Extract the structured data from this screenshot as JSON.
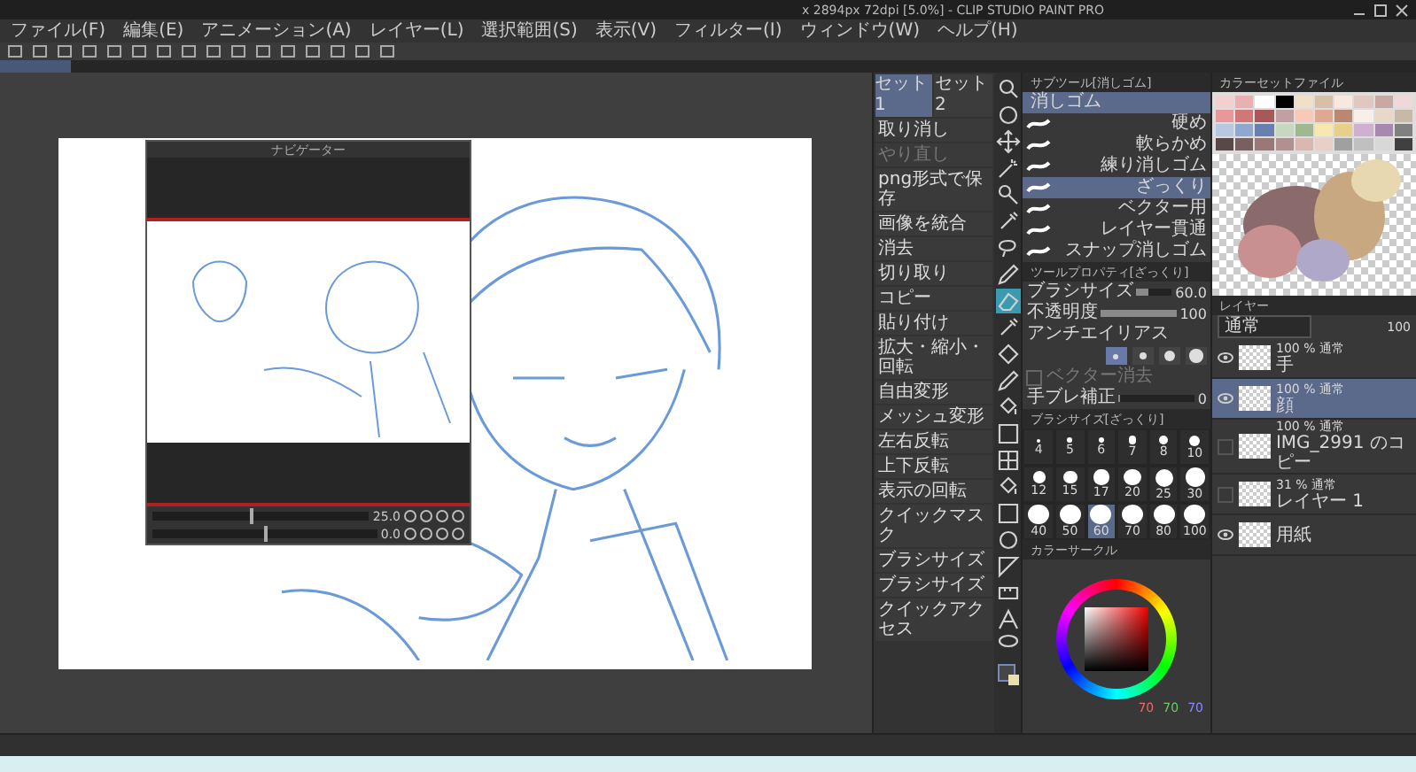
{
  "window": {
    "title": "x 2894px 72dpi [5.0%] - CLIP STUDIO PAINT PRO"
  },
  "menu": [
    "ファイル(F)",
    "編集(E)",
    "アニメーション(A)",
    "レイヤー(L)",
    "選択範囲(S)",
    "表示(V)",
    "フィルター(I)",
    "ウィンドウ(W)",
    "ヘルプ(H)"
  ],
  "navigator": {
    "title": "ナビゲーター",
    "zoom": "25.0",
    "rotation": "0.0",
    "zoom_slider": {
      "level": 0.45
    },
    "rotation_slider": {
      "level": 0.5
    }
  },
  "auto_actions": {
    "sets": [
      {
        "label": "セット1",
        "selected": true
      },
      {
        "label": "セット2",
        "selected": false
      }
    ],
    "items": [
      {
        "label": "取り消し",
        "disabled": false
      },
      {
        "label": "やり直し",
        "disabled": true
      },
      {
        "label": "png形式で保存",
        "disabled": false
      },
      {
        "label": "画像を統合",
        "disabled": false
      },
      {
        "label": "消去",
        "disabled": false
      },
      {
        "label": "切り取り",
        "disabled": false
      },
      {
        "label": "コピー",
        "disabled": false
      },
      {
        "label": "貼り付け",
        "disabled": false
      },
      {
        "label": "拡大・縮小・回転",
        "disabled": false
      },
      {
        "label": "自由変形",
        "disabled": false
      },
      {
        "label": "メッシュ変形",
        "disabled": false
      },
      {
        "label": "左右反転",
        "disabled": false
      },
      {
        "label": "上下反転",
        "disabled": false
      },
      {
        "label": "表示の回転",
        "disabled": false
      },
      {
        "label": "クイックマスク",
        "disabled": false
      },
      {
        "label": "ブラシサイズ",
        "disabled": false
      },
      {
        "label": "ブラシサイズ",
        "disabled": false
      },
      {
        "label": "クイックアクセス",
        "disabled": false
      }
    ]
  },
  "tools": [
    {
      "kind": "magnifier",
      "selected": false
    },
    {
      "kind": "circle",
      "selected": false
    },
    {
      "kind": "move",
      "selected": false
    },
    {
      "kind": "wand",
      "selected": false
    },
    {
      "kind": "search",
      "selected": false
    },
    {
      "kind": "dropper",
      "selected": false
    },
    {
      "kind": "lasso",
      "selected": false
    },
    {
      "kind": "pen",
      "selected": false
    },
    {
      "kind": "eraser",
      "selected": true
    },
    {
      "kind": "dropper",
      "selected": false
    },
    {
      "kind": "blend",
      "selected": false
    },
    {
      "kind": "pen",
      "selected": false
    },
    {
      "kind": "fill",
      "selected": false
    },
    {
      "kind": "gradient",
      "selected": false
    },
    {
      "kind": "grid",
      "selected": false
    },
    {
      "kind": "fill",
      "selected": false
    },
    {
      "kind": "gradient",
      "selected": false
    },
    {
      "kind": "circle",
      "selected": false
    },
    {
      "kind": "frame",
      "selected": false
    },
    {
      "kind": "ruler",
      "selected": false
    },
    {
      "kind": "text",
      "selected": false
    },
    {
      "kind": "balloon",
      "selected": false
    }
  ],
  "sub_tool": {
    "title": "サブツール[消しゴム]",
    "group": "消しゴム",
    "items": [
      {
        "label": "硬め",
        "selected": false
      },
      {
        "label": "軟らかめ",
        "selected": false
      },
      {
        "label": "練り消しゴム",
        "selected": false
      },
      {
        "label": "ざっくり",
        "selected": true
      },
      {
        "label": "ベクター用",
        "selected": false
      },
      {
        "label": "レイヤー貫通",
        "selected": false
      },
      {
        "label": "スナップ消しゴム",
        "selected": false
      }
    ]
  },
  "tool_property": {
    "title": "ツールプロパティ[ざっくり]",
    "brush_size": {
      "label": "ブラシサイズ",
      "value": "60.0",
      "level": 0.35
    },
    "opacity": {
      "label": "不透明度",
      "value": "100",
      "level": 1
    },
    "antialias": {
      "label": "アンチエイリアス",
      "options": [
        {
          "selected": true
        },
        {
          "selected": false
        },
        {
          "selected": false
        },
        {
          "selected": false
        }
      ]
    },
    "vector_erase": {
      "label": "ベクター消去",
      "checked": false
    },
    "stabilization": {
      "label": "手ブレ補正",
      "value": "0",
      "level": 0
    }
  },
  "brush_sizes": {
    "title": "ブラシサイズ[ざっくり]",
    "items": [
      {
        "label": "4",
        "selected": false
      },
      {
        "label": "5",
        "selected": false
      },
      {
        "label": "6",
        "selected": false
      },
      {
        "label": "7",
        "selected": false
      },
      {
        "label": "8",
        "selected": false
      },
      {
        "label": "10",
        "selected": false
      },
      {
        "label": "12",
        "selected": false
      },
      {
        "label": "15",
        "selected": false
      },
      {
        "label": "17",
        "selected": false
      },
      {
        "label": "20",
        "selected": false
      },
      {
        "label": "25",
        "selected": false
      },
      {
        "label": "30",
        "selected": false
      },
      {
        "label": "40",
        "selected": false
      },
      {
        "label": "50",
        "selected": false
      },
      {
        "label": "60",
        "selected": true
      },
      {
        "label": "70",
        "selected": false
      },
      {
        "label": "80",
        "selected": false
      },
      {
        "label": "100",
        "selected": false
      }
    ]
  },
  "color_circle": {
    "title": "カラーサークル",
    "r": "70",
    "g": "70",
    "b": "70"
  },
  "color_set": {
    "title": "カラーセットファイル",
    "swatches": [
      {
        "color": "#f2d0d0"
      },
      {
        "color": "#e8b0b0"
      },
      {
        "color": "#ffffff"
      },
      {
        "color": "#000000"
      },
      {
        "color": "#f0e0c8"
      },
      {
        "color": "#d8c0a8"
      },
      {
        "color": "#f8e8e0"
      },
      {
        "color": "#e0c8c0"
      },
      {
        "color": "#c8a8a0"
      },
      {
        "color": "#f0d8d8"
      },
      {
        "color": "#e89898"
      },
      {
        "color": "#d07878"
      },
      {
        "color": "#a85858"
      },
      {
        "color": "#c0a0a0"
      },
      {
        "color": "#f8c8b8"
      },
      {
        "color": "#e0a890"
      },
      {
        "color": "#b88870"
      },
      {
        "color": "#f8f0e8"
      },
      {
        "color": "#e8d8c8"
      },
      {
        "color": "#c8b8a8"
      },
      {
        "color": "#b8c8e0"
      },
      {
        "color": "#90a8d0"
      },
      {
        "color": "#6880b0"
      },
      {
        "color": "#c8d8c0"
      },
      {
        "color": "#a0b890"
      },
      {
        "color": "#f8e8b0"
      },
      {
        "color": "#e8d088"
      },
      {
        "color": "#d0b0d0"
      },
      {
        "color": "#a888b0"
      },
      {
        "color": "#808080"
      },
      {
        "color": "#584848"
      },
      {
        "color": "#786060"
      },
      {
        "color": "#987878"
      },
      {
        "color": "#b09090"
      },
      {
        "color": "#d8b8b0"
      },
      {
        "color": "#e8d0c8"
      },
      {
        "color": "#a0a0a0"
      },
      {
        "color": "#c0c0c0"
      },
      {
        "color": "#d8d8d8"
      },
      {
        "color": "#404040"
      }
    ]
  },
  "layers": {
    "title": "レイヤー",
    "blend": "通常",
    "opacity": "100",
    "items": [
      {
        "mode": "100 % 通常",
        "name": "手",
        "visible": true,
        "selected": false
      },
      {
        "mode": "100 % 通常",
        "name": "顔",
        "visible": true,
        "selected": true
      },
      {
        "mode": "100 % 通常",
        "name": "IMG_2991 のコピー",
        "visible": false,
        "selected": false
      },
      {
        "mode": "31 % 通常",
        "name": "レイヤー 1",
        "visible": false,
        "selected": false
      },
      {
        "name": "用紙",
        "visible": true,
        "selected": false
      }
    ]
  }
}
